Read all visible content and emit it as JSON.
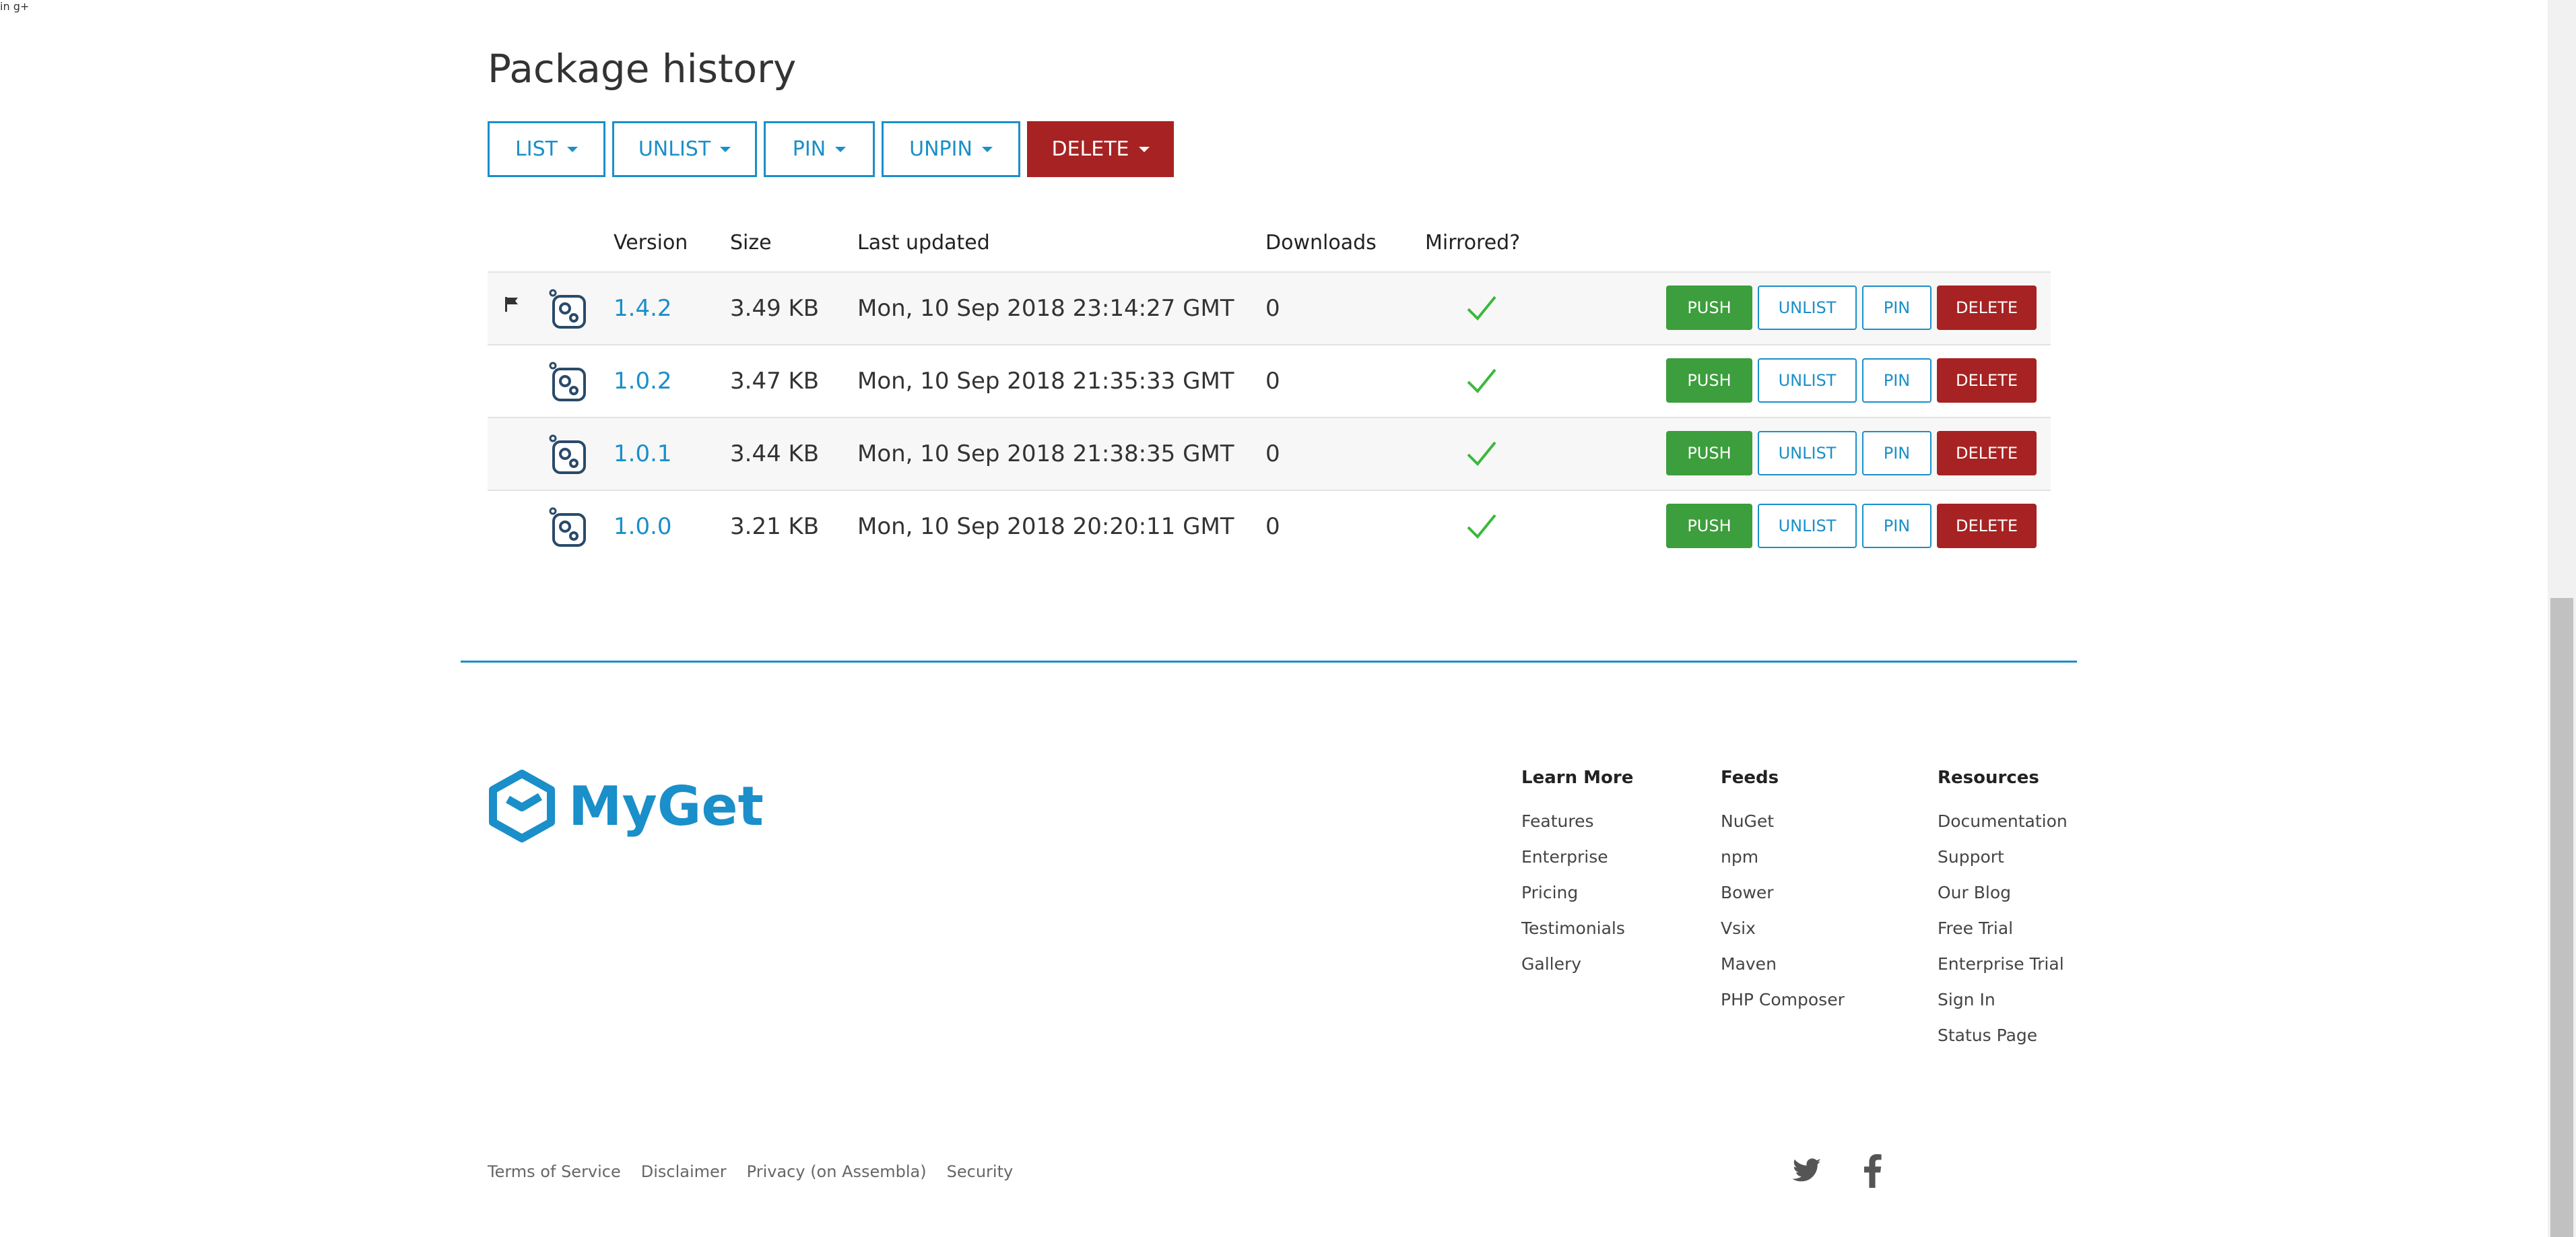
{
  "page": {
    "title": "Package history"
  },
  "bulk_actions": [
    {
      "label": "LIST"
    },
    {
      "label": "UNLIST"
    },
    {
      "label": "PIN"
    },
    {
      "label": "UNPIN"
    },
    {
      "label": "DELETE"
    }
  ],
  "table": {
    "headers": {
      "version": "Version",
      "size": "Size",
      "last_updated": "Last updated",
      "downloads": "Downloads",
      "mirrored": "Mirrored?"
    },
    "rows": [
      {
        "version": "1.4.2",
        "size": "3.49 KB",
        "last_updated": "Mon, 10 Sep 2018 23:14:27 GMT",
        "downloads": "0",
        "mirrored": true,
        "flagged": true
      },
      {
        "version": "1.0.2",
        "size": "3.47 KB",
        "last_updated": "Mon, 10 Sep 2018 21:35:33 GMT",
        "downloads": "0",
        "mirrored": true,
        "flagged": false
      },
      {
        "version": "1.0.1",
        "size": "3.44 KB",
        "last_updated": "Mon, 10 Sep 2018 21:38:35 GMT",
        "downloads": "0",
        "mirrored": true,
        "flagged": false
      },
      {
        "version": "1.0.0",
        "size": "3.21 KB",
        "last_updated": "Mon, 10 Sep 2018 20:20:11 GMT",
        "downloads": "0",
        "mirrored": true,
        "flagged": false
      }
    ],
    "row_actions": {
      "push": "PUSH",
      "unlist": "UNLIST",
      "pin": "PIN",
      "delete": "DELETE"
    }
  },
  "footer": {
    "brand": "MyGet",
    "columns": [
      {
        "title": "Learn More",
        "links": [
          "Features",
          "Enterprise",
          "Pricing",
          "Testimonials",
          "Gallery"
        ]
      },
      {
        "title": "Feeds",
        "links": [
          "NuGet",
          "npm",
          "Bower",
          "Vsix",
          "Maven",
          "PHP Composer"
        ]
      },
      {
        "title": "Resources",
        "links": [
          "Documentation",
          "Support",
          "Our Blog",
          "Free Trial",
          "Enterprise Trial",
          "Sign In",
          "Status Page"
        ]
      }
    ],
    "legal": [
      "Terms of Service",
      "Disclaimer",
      "Privacy (on Assembla)",
      "Security"
    ],
    "social": [
      {
        "icon": "twitter-icon"
      },
      {
        "icon": "facebook-icon"
      },
      {
        "icon": "linkedin-icon",
        "label": "in"
      },
      {
        "icon": "google-plus-icon",
        "label": "g+"
      }
    ]
  },
  "colors": {
    "accent": "#1a8fc9",
    "danger": "#a72222",
    "success": "#3c9e3c"
  }
}
